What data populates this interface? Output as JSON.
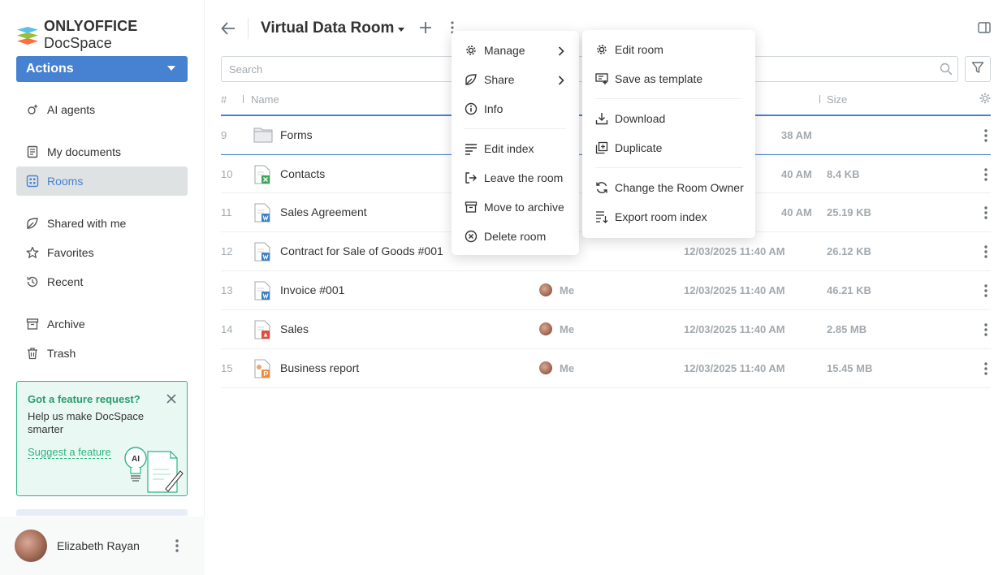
{
  "app": {
    "logo_brand": "ONLYOFFICE",
    "logo_product": "DocSpace"
  },
  "sidebar": {
    "actions_label": "Actions",
    "items": [
      {
        "label": "AI agents"
      },
      {
        "label": "My documents"
      },
      {
        "label": "Rooms"
      },
      {
        "label": "Shared with me"
      },
      {
        "label": "Favorites"
      },
      {
        "label": "Recent"
      },
      {
        "label": "Archive"
      },
      {
        "label": "Trash"
      }
    ],
    "feature_card": {
      "title": "Got a feature request?",
      "body": "Help us make DocSpace smarter",
      "link": "Suggest a feature",
      "illus_text": "AI"
    },
    "profile": {
      "name": "Elizabeth Rayan"
    }
  },
  "header": {
    "title": "Virtual Data Room"
  },
  "search": {
    "placeholder": "Search"
  },
  "table": {
    "columns": {
      "num": "#",
      "name": "Name",
      "size": "Size"
    },
    "rows": [
      {
        "num": "9",
        "name": "Forms",
        "type": "folder",
        "author": "",
        "date": "38 AM",
        "size": ""
      },
      {
        "num": "10",
        "name": "Contacts",
        "type": "xlsx",
        "author": "",
        "date": "40 AM",
        "size": "8.4 KB"
      },
      {
        "num": "11",
        "name": "Sales Agreement",
        "type": "docx",
        "author": "",
        "date": "40 AM",
        "size": "25.19 KB"
      },
      {
        "num": "12",
        "name": "Contract for Sale of Goods #001",
        "type": "docx",
        "author": "",
        "date": "12/03/2025 11:40 AM",
        "size": "26.12 KB"
      },
      {
        "num": "13",
        "name": "Invoice #001",
        "type": "docx",
        "author": "Me",
        "date": "12/03/2025 11:40 AM",
        "size": "46.21 KB"
      },
      {
        "num": "14",
        "name": "Sales",
        "type": "pdf",
        "author": "Me",
        "date": "12/03/2025 11:40 AM",
        "size": "2.85 MB"
      },
      {
        "num": "15",
        "name": "Business report",
        "type": "pptx",
        "author": "Me",
        "date": "12/03/2025 11:40 AM",
        "size": "15.45 MB"
      }
    ]
  },
  "context_menu": {
    "items": [
      {
        "label": "Manage"
      },
      {
        "label": "Share"
      },
      {
        "label": "Info"
      },
      {
        "label": "Edit index"
      },
      {
        "label": "Leave the room"
      },
      {
        "label": "Move to archive"
      },
      {
        "label": "Delete room"
      }
    ]
  },
  "submenu": {
    "items": [
      {
        "label": "Edit room"
      },
      {
        "label": "Save as template"
      },
      {
        "label": "Download"
      },
      {
        "label": "Duplicate"
      },
      {
        "label": "Change the Room Owner"
      },
      {
        "label": "Export room index"
      }
    ]
  },
  "colors": {
    "accent": "#4781d1",
    "feature_green": "#2db482",
    "muted": "#a3a9ae"
  }
}
